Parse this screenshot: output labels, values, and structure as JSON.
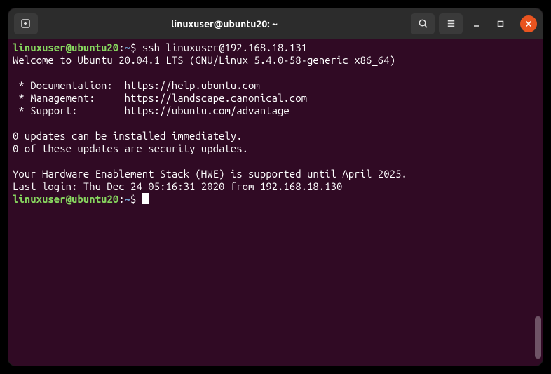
{
  "titlebar": {
    "title": "linuxuser@ubuntu20: ~"
  },
  "terminal": {
    "prompt1": {
      "user": "linuxuser@ubuntu20",
      "path": "~",
      "command": "ssh linuxuser@192.168.18.131"
    },
    "welcome": "Welcome to Ubuntu 20.04.1 LTS (GNU/Linux 5.4.0-58-generic x86_64)",
    "doc_line": " * Documentation:  https://help.ubuntu.com",
    "mgmt_line": " * Management:     https://landscape.canonical.com",
    "support_line": " * Support:        https://ubuntu.com/advantage",
    "updates1": "0 updates can be installed immediately.",
    "updates2": "0 of these updates are security updates.",
    "hwe": "Your Hardware Enablement Stack (HWE) is supported until April 2025.",
    "last_login": "Last login: Thu Dec 24 05:16:31 2020 from 192.168.18.130",
    "prompt2": {
      "user": "linuxuser@ubuntu20",
      "path": "~"
    }
  }
}
